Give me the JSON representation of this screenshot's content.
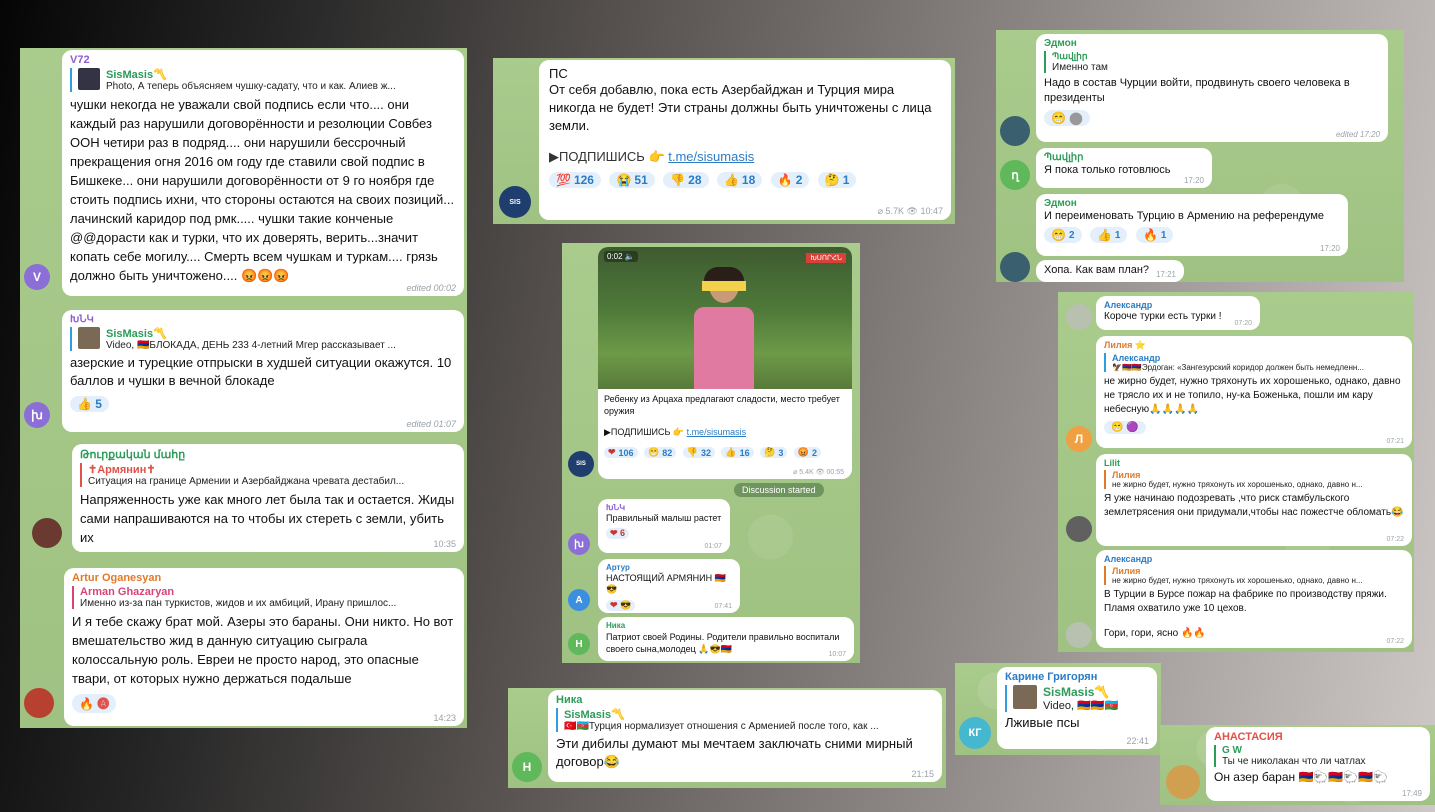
{
  "p1": {
    "b1": {
      "sender": "V72",
      "chan_title": "SisMasis〽️",
      "chan_text": "Photo, А теперь объясняем чушку-садату, что и как. Алиев ж...",
      "text": "чушки некогда не уважали свой подпись если что.... они каждый раз нарушили договорённости и резолюции Совбез ООН четири раз в подряд.... они нарушили бессрочный прекращения огня 2016 ом году где ставили свой подпис в Бишкеке... они нарушили договорённости от 9 го ноября где стоить подпись ихни, что стороны остаются на своих позиций... лачинский каридор под рмк..... чушки такие конченые @@дорасти как и турки, что их доверять, верить...значит копать себе могилу.... Смерть всем чушкам и туркам.... грязь должно быть уничтожено.... 😡😡😡",
      "meta": "edited 00:02",
      "avatar": "V"
    },
    "b2": {
      "sender": "ԽՆԿ",
      "chan_title": "SisMasis〽️",
      "chan_text": "Video, 🇦🇲БЛОКАДА, ДЕНЬ 233 4-летний Мгер рассказывает ...",
      "text": "азерские и турецкие отпрыски в худшей ситуации окажутся. 10 баллов и чушки в вечной блокаде",
      "react": "👍 5",
      "meta": "edited 01:07",
      "avatar": "խ"
    },
    "b3": {
      "sender": "Թուրքական մահը",
      "q_name": "✝Армянин✝",
      "q_text": "Ситуация на границе Армении и Азербайджана чревата дестабил...",
      "text": "Напряженность уже как много лет была так и остается. Жиды сами напрашиваются на то чтобы их стереть с земли, убить их",
      "meta": "10:35"
    },
    "b4": {
      "sender": "Artur Oganesyan",
      "q_name": "Arman Ghazaryan",
      "q_text": "Именно из-за пан туркистов, жидов и их амбиций, Ирану пришлос...",
      "text": "И я тебе скажу брат мой. Азеры это бараны. Они никто. Но вот вмешательство жид в данную ситуацию сыграла колоссальную роль. Евреи не просто народ, это опасные твари, от которых нужно держаться подальше",
      "react": "🔥 🅐",
      "meta": "14:23"
    }
  },
  "p2": {
    "title": "ПС",
    "text": "От себя добавлю, пока есть Азербайджан и Турция мира никогда не будет! Эти страны должны быть уничтожены с лица земли.",
    "sub": "▶ПОДПИШИСЬ 👉 ",
    "link": "t.me/sisumasis",
    "reactions": [
      {
        "e": "💯",
        "n": "126"
      },
      {
        "e": "😭",
        "n": "51"
      },
      {
        "e": "👎",
        "n": "28"
      },
      {
        "e": "👍",
        "n": "18"
      },
      {
        "e": "🔥",
        "n": "2"
      },
      {
        "e": "🤔",
        "n": "1"
      }
    ],
    "meta": "⌀ 5.7K 👁 10:47"
  },
  "p3": {
    "video_time": "0:02 🔈",
    "badge": "ԽՍՈՐՀՆ",
    "caption": "Ребенку из Арцаха предлагают сладости, место требует оружия",
    "sub": "▶ПОДПИШИСЬ 👉 ",
    "link": "t.me/sisumasis",
    "reactions": [
      {
        "e": "❤",
        "n": "106"
      },
      {
        "e": "😁",
        "n": "82"
      },
      {
        "e": "👎",
        "n": "32"
      },
      {
        "e": "👍",
        "n": "16"
      },
      {
        "e": "🤔",
        "n": "3"
      },
      {
        "e": "😡",
        "n": "2"
      }
    ],
    "meta": "⌀ 5.4K 👁 00:55",
    "started": "Discussion started",
    "c1": {
      "sender": "ԽՆԿ",
      "text": "Правильный малыш растет",
      "react": "❤ 6",
      "meta": "01:07",
      "avatar": "խ"
    },
    "c2": {
      "sender": "Артур",
      "text": "НАСТОЯЩИЙ АРМЯНИН 🇦🇲😎",
      "react": "❤ 😎",
      "meta": "07:41",
      "avatar": "A"
    },
    "c3": {
      "sender": "Ника",
      "text": "Патриот своей Родины. Родители правильно воспитали своего сына,молодец 🙏😎🇦🇲",
      "meta": "10:07",
      "avatar": "H"
    }
  },
  "p4": {
    "sender": "Ника",
    "chan_title": "SisMasis〽️",
    "chan_text": "🇹🇷🇦🇿Турция нормализует отношения с Арменией после того, как ...",
    "text": "Эти дибилы думают мы мечтаем заключать сними мирный договор😂",
    "meta": "21:15",
    "avatar": "H"
  },
  "p5": {
    "b1": {
      "sender": "Эдмон",
      "q_name": "Պավլիր",
      "q_text": "Именно там",
      "text": "Надо в состав Чурции войти, продвинуть своего человека в президенты",
      "react": "😁 ⬤",
      "meta": "edited 17:20"
    },
    "b2": {
      "sender": "Պավլիր",
      "text": "Я пока только готовлюсь",
      "meta": "17:20",
      "avatar": "ղ"
    },
    "b3": {
      "sender": "Эдмон",
      "text": "И переименовать Турцию в Армению на референдуме",
      "reactions": [
        {
          "e": "😁",
          "n": "2"
        },
        {
          "e": "👍",
          "n": "1"
        },
        {
          "e": "🔥",
          "n": "1"
        }
      ],
      "meta": "17:20"
    },
    "b4": {
      "text": "Хопа. Как вам план?",
      "meta": "17:21"
    }
  },
  "p6": {
    "b1": {
      "sender": "Александр",
      "text": "Короче турки есть турки !",
      "meta": "07:20"
    },
    "b2": {
      "sender": "Лилия ⭐",
      "q_name": "Александр",
      "q_text": "🦅🇦🇲🇦🇲Эрдоган: «Зангезурский коридор должен быть немедленн...",
      "text": "не жирно будет, нужно тряхонуть их хорошенько, однако, давно не трясло их и не топило, ну-ка Боженька, пошли им кару небесную🙏🙏🙏🙏",
      "react": "😁 🟣",
      "meta": "07:21",
      "avatar": "Л"
    },
    "b3": {
      "sender": "Lilit",
      "q_name": "Лилия",
      "q_text": "не жирно будет, нужно тряхонуть их хорошенько, однако, давно н...",
      "text": "Я уже начинаю подозревать ,что риск стамбульского землетрясения они придумали,чтобы нас пожестче обломать😂",
      "meta": "07:22"
    },
    "b4": {
      "sender": "Александр",
      "q_name": "Лилия",
      "q_text": "не жирно будет, нужно тряхонуть их хорошенько, однако, давно н...",
      "text": "В Турции в Бурсе пожар на фабрике по производству пряжи. Пламя охватило уже 10 цехов.",
      "text2": "Гори, гори, ясно 🔥🔥",
      "meta": "07:22"
    }
  },
  "p7": {
    "sender": "Карине Григорян",
    "chan_title": "SisMasis〽️",
    "chan_text": "Video, 🇦🇲🇦🇲🇦🇿",
    "text": "Лживые псы",
    "meta": "22:41",
    "avatar": "КГ"
  },
  "p8": {
    "sender": "АНАСТАСИЯ",
    "q_name": "G W",
    "q_text": "Ты че николакан что ли чатлах",
    "text": "Он азер баран 🇦🇲🐑🇦🇲🐑🇦🇲🐑",
    "meta": "17:49"
  }
}
